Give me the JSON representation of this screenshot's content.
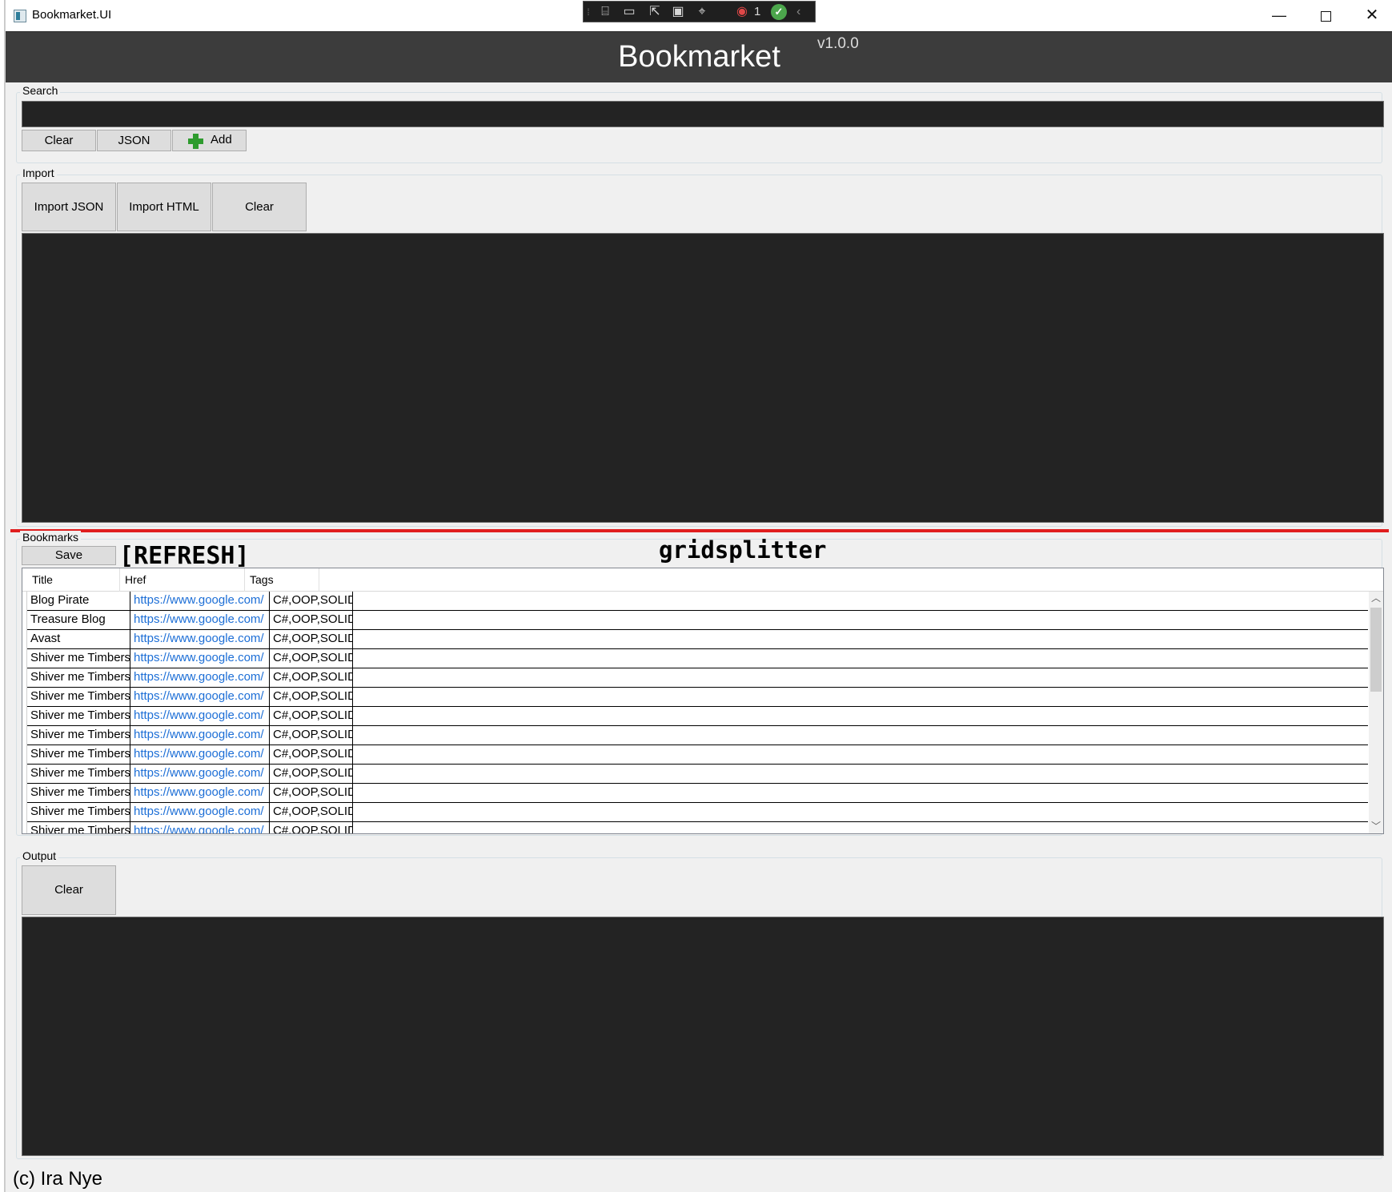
{
  "window": {
    "title": "Bookmarket.UI",
    "controls": {
      "minimize": "—",
      "close": "✕"
    }
  },
  "debug_toolbar": {
    "count": "1",
    "collapse": "‹"
  },
  "header": {
    "title": "Bookmarket",
    "version": "v1.0.0"
  },
  "search": {
    "label": "Search",
    "value": "",
    "buttons": {
      "clear": "Clear",
      "json": "JSON",
      "add": "Add"
    }
  },
  "import": {
    "label": "Import",
    "buttons": {
      "import_json": "Import JSON",
      "import_html": "Import HTML",
      "clear": "Clear"
    },
    "content": ""
  },
  "annotations": {
    "refresh": "[REFRESH]",
    "splitter": "gridsplitter",
    "splitter_color": "#e01e1e"
  },
  "bookmarks": {
    "label": "Bookmarks",
    "save_label": "Save",
    "columns": [
      "Title",
      "Href",
      "Tags"
    ],
    "rows": [
      {
        "title": "Blog Pirate",
        "href": "https://www.google.com/",
        "tags": "C#,OOP,SOLID"
      },
      {
        "title": "Treasure Blog",
        "href": "https://www.google.com/",
        "tags": "C#,OOP,SOLID"
      },
      {
        "title": "Avast",
        "href": "https://www.google.com/",
        "tags": "C#,OOP,SOLID"
      },
      {
        "title": "Shiver me Timbers",
        "href": "https://www.google.com/",
        "tags": "C#,OOP,SOLID"
      },
      {
        "title": "Shiver me Timbers",
        "href": "https://www.google.com/",
        "tags": "C#,OOP,SOLID"
      },
      {
        "title": "Shiver me Timbers",
        "href": "https://www.google.com/",
        "tags": "C#,OOP,SOLID"
      },
      {
        "title": "Shiver me Timbers",
        "href": "https://www.google.com/",
        "tags": "C#,OOP,SOLID"
      },
      {
        "title": "Shiver me Timbers",
        "href": "https://www.google.com/",
        "tags": "C#,OOP,SOLID"
      },
      {
        "title": "Shiver me Timbers",
        "href": "https://www.google.com/",
        "tags": "C#,OOP,SOLID"
      },
      {
        "title": "Shiver me Timbers",
        "href": "https://www.google.com/",
        "tags": "C#,OOP,SOLID"
      },
      {
        "title": "Shiver me Timbers",
        "href": "https://www.google.com/",
        "tags": "C#,OOP,SOLID"
      },
      {
        "title": "Shiver me Timbers",
        "href": "https://www.google.com/",
        "tags": "C#,OOP,SOLID"
      },
      {
        "title": "Shiver me Timbers",
        "href": "https://www.google.com/",
        "tags": "C#,OOP,SOLID"
      }
    ]
  },
  "output": {
    "label": "Output",
    "clear_label": "Clear",
    "content": ""
  },
  "footer": {
    "text": "(c) Ira Nye"
  },
  "colors": {
    "header_bg": "#3c3c3c",
    "textbox_bg": "#232323",
    "link": "#1c6ed6",
    "add_icon": "#2e9b2e"
  }
}
